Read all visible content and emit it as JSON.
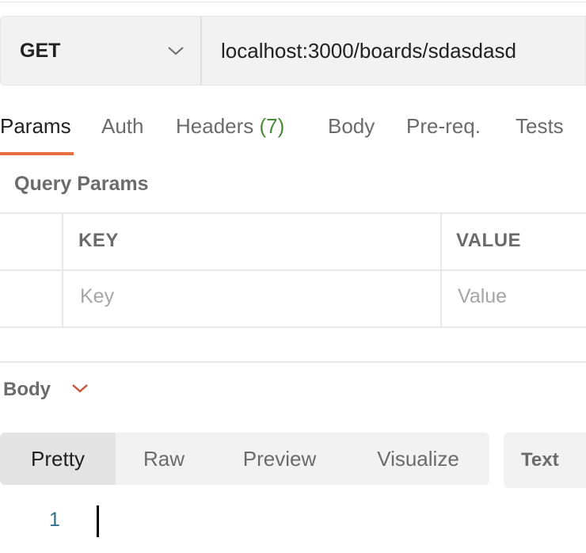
{
  "request": {
    "method": "GET",
    "url": "localhost:3000/boards/sdasdasd"
  },
  "tabs": [
    {
      "label": "Params",
      "active": true
    },
    {
      "label": "Auth"
    },
    {
      "label": "Headers",
      "count": "(7)"
    },
    {
      "label": "Body"
    },
    {
      "label": "Pre-req."
    },
    {
      "label": "Tests"
    }
  ],
  "query_params": {
    "title": "Query Params",
    "columns": {
      "key": "KEY",
      "value": "VALUE"
    },
    "placeholders": {
      "key": "Key",
      "value": "Value"
    }
  },
  "response": {
    "title": "Body",
    "views": [
      "Pretty",
      "Raw",
      "Preview",
      "Visualize"
    ],
    "active_view": "Pretty",
    "format": "Text",
    "line_number": "1"
  },
  "colors": {
    "accent": "#e86f44",
    "count_green": "#4a8a3a",
    "line_number": "#2f6f8a"
  },
  "icons": {
    "method_dropdown": "chevron-down-icon",
    "response_toggle": "chevron-down-icon"
  }
}
